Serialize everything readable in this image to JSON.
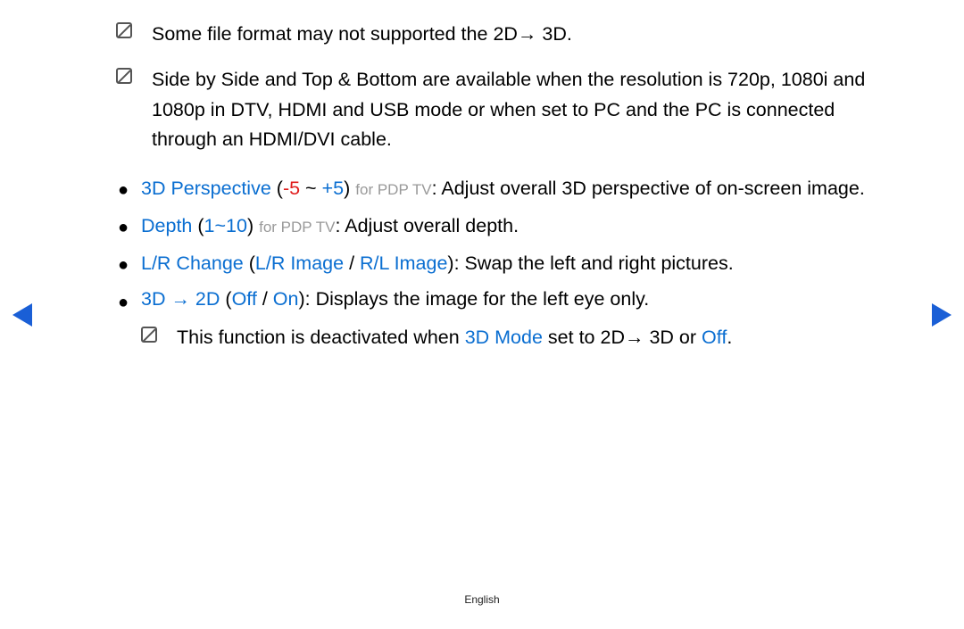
{
  "notes": {
    "n1": "Some file format may not supported the",
    "n1_mode": "2D→ 3D",
    "n1_end": ".",
    "n2": "Side by Side",
    "n2_and": "and",
    "n2_b": "Top & Bottom",
    "n2_rest": "are available when the resolution is 720p, 1080i and 1080p in DTV, HDMI and USB mode or when set to PC and the PC is connected through an HDMI/DVI cable."
  },
  "items": {
    "perspective": {
      "label": "3D Perspective",
      "open": "(",
      "neg": "-5",
      "sep": " ~ ",
      "pos": "+5",
      "close": ")",
      "tag": "for PDP TV",
      "desc": ": Adjust overall 3D perspective of on-screen image."
    },
    "depth": {
      "label": "Depth",
      "open": "(",
      "range": "1~10",
      "close": ")",
      "tag": "for PDP TV",
      "desc": ": Adjust overall depth."
    },
    "lr": {
      "label": "L/R Change",
      "open": "(",
      "opt1": "L/R Image",
      "slash": " / ",
      "opt2": "R/L Image",
      "close": ")",
      "desc": ": Swap the left and right pictures."
    },
    "conv": {
      "label": "3D → 2D",
      "open": "(",
      "off": "Off",
      "slash": " / ",
      "on": "On",
      "close": ")",
      "desc": ": Displays the image for the left eye only."
    },
    "subnote": {
      "a": "This function is deactivated when ",
      "mode": "3D Mode",
      "b": " set to ",
      "m2": "2D→ 3D",
      "or": " or ",
      "off": "Off",
      "end": "."
    }
  },
  "footer": "English"
}
